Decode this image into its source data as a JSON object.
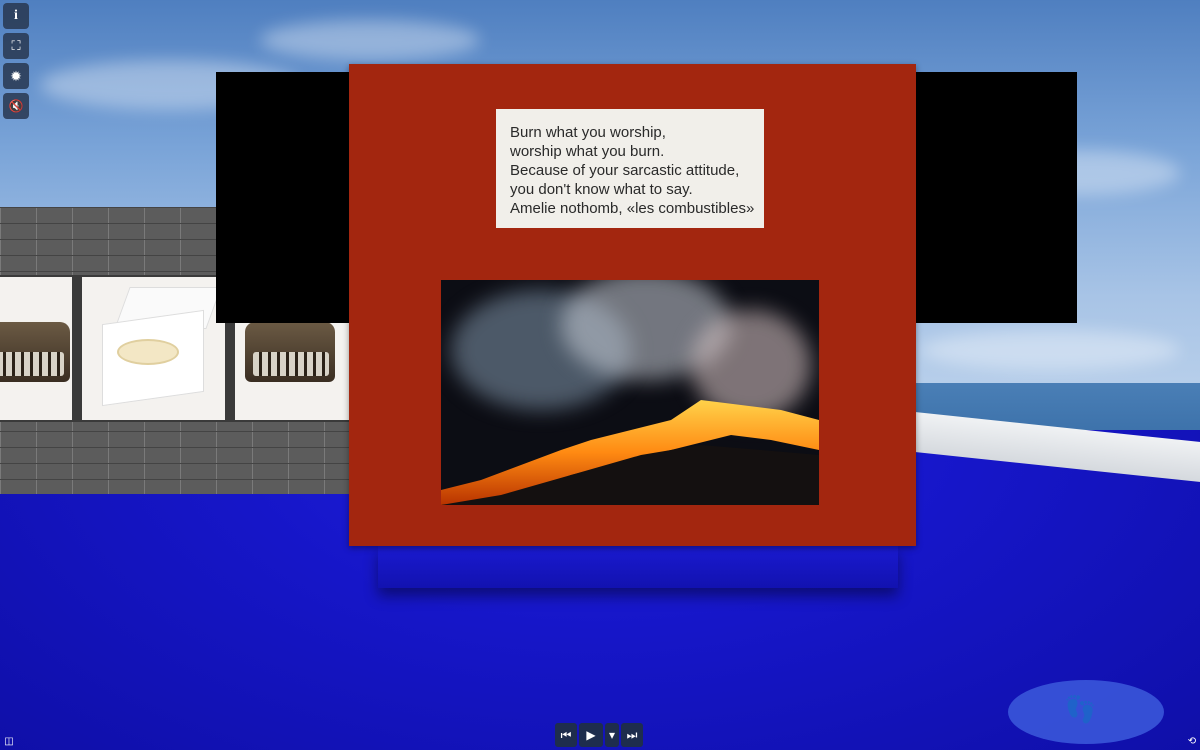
{
  "toolbar": {
    "items": [
      {
        "icon": "info-icon",
        "glyph": "i"
      },
      {
        "icon": "fullscreen-icon",
        "glyph": "⛶"
      },
      {
        "icon": "gear-icon",
        "glyph": "✹"
      },
      {
        "icon": "mute-icon",
        "glyph": "🔇"
      }
    ]
  },
  "quote": {
    "lines": [
      "Burn what you worship,",
      "worship what you burn.",
      "Because of your sarcastic attitude,",
      "you don't know what to say.",
      "Amelie nothomb, «les combustibles»"
    ]
  },
  "media": {
    "controls": [
      {
        "icon": "previous-icon",
        "glyph": "⏮"
      },
      {
        "icon": "play-icon",
        "glyph": "▶"
      },
      {
        "icon": "dropdown-icon",
        "glyph": "▾"
      },
      {
        "icon": "next-icon",
        "glyph": "⏭"
      }
    ]
  },
  "walk_pad": {
    "icon": "footprints-icon",
    "glyph": "👣"
  },
  "corner_icons": {
    "left": {
      "icon": "map-icon",
      "glyph": "◫"
    },
    "right": {
      "icon": "reset-view-icon",
      "glyph": "⟲"
    }
  },
  "colors": {
    "board_red": "#a3260f",
    "floor_blue": "#1616c8",
    "toolbar_bg": "#28374f"
  }
}
